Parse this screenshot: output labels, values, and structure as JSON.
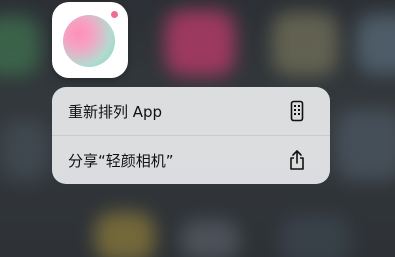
{
  "app": {
    "icon_name": "camera-app-icon",
    "accent_color": "#f06b98"
  },
  "menu": {
    "items": [
      {
        "label": "重新排列 App",
        "icon": "phone-rearrange-icon"
      },
      {
        "label": "分享“轻颜相机”",
        "icon": "share-icon"
      }
    ]
  }
}
